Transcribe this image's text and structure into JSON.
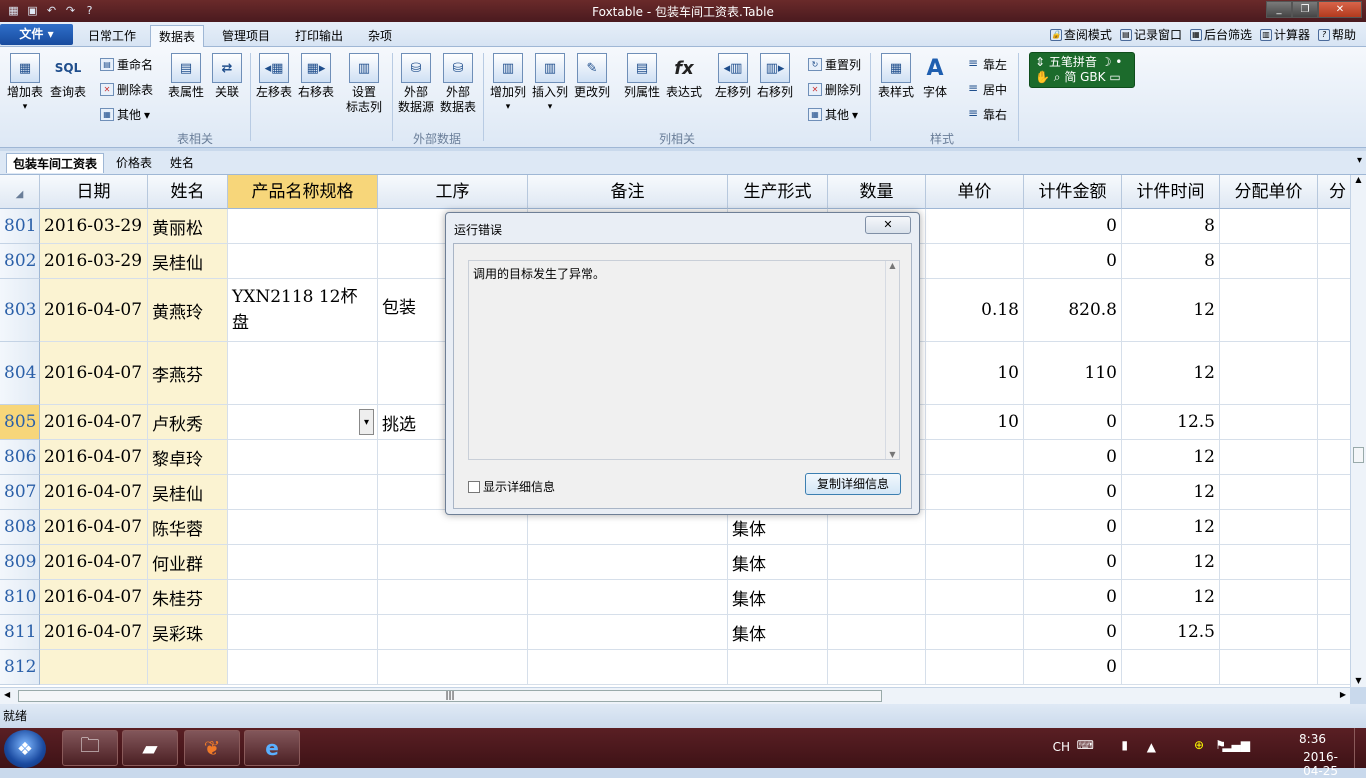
{
  "window": {
    "title": "Foxtable - 包装车间工资表.Table"
  },
  "menu": {
    "file_label": "文件",
    "tabs": [
      "日常工作",
      "数据表",
      "管理项目",
      "打印输出",
      "杂项"
    ],
    "active_tab": "数据表",
    "right_links": [
      "查阅模式",
      "记录窗口",
      "后台筛选",
      "计算器",
      "帮助"
    ]
  },
  "ribbon": {
    "add_table": "增加表",
    "query_table": "查询表",
    "sql": "SQL",
    "rename_table": "重命名",
    "delete_table": "删除表",
    "other": "其他",
    "table_props": "表属性",
    "relation": "关联",
    "move_left": "左移表",
    "move_right": "右移表",
    "set_flag_col": "设置\n标志列",
    "ext_source": "外部\n数据源",
    "ext_table": "外部\n数据表",
    "add_col": "增加列",
    "insert_col": "插入列",
    "change_col": "更改列",
    "col_props": "列属性",
    "expression": "表达式",
    "fx": "fx",
    "col_left": "左移列",
    "col_right": "右移列",
    "reset_col": "重置列",
    "delete_col": "删除列",
    "other2": "其他",
    "table_style": "表样式",
    "font": "字体",
    "font_glyph": "A",
    "align_left": "靠左",
    "align_center": "居中",
    "align_right": "靠右",
    "groups": {
      "table": "表相关",
      "external": "外部数据",
      "column": "列相关",
      "style": "样式"
    }
  },
  "ime": {
    "line1": "五笔拼音",
    "line2": "简 GBK"
  },
  "sheets": {
    "tabs": [
      "包装车间工资表",
      "价格表",
      "姓名"
    ],
    "active": "包装车间工资表"
  },
  "grid": {
    "columns": [
      "日期",
      "姓名",
      "产品名称规格",
      "工序",
      "备注",
      "生产形式",
      "数量",
      "单价",
      "计件金额",
      "计件时间",
      "分配单价",
      "分"
    ],
    "rows": [
      {
        "id": "801",
        "date": "2016-03-29",
        "name": "黄丽松",
        "product": "",
        "process": "",
        "note": "",
        "form": "",
        "qty": "",
        "price": "",
        "amount": "0",
        "time": "8"
      },
      {
        "id": "802",
        "date": "2016-03-29",
        "name": "吴桂仙",
        "product": "",
        "process": "",
        "note": "",
        "form": "",
        "qty": "",
        "price": "",
        "amount": "0",
        "time": "8"
      },
      {
        "id": "803",
        "date": "2016-04-07",
        "name": "黄燕玲",
        "product": "YXN2118  12杯盘",
        "process": "包装",
        "note": "",
        "form": "",
        "qty": "",
        "price": "0.18",
        "amount": "820.8",
        "time": "12"
      },
      {
        "id": "804",
        "date": "2016-04-07",
        "name": "李燕芬",
        "product": "",
        "process": "",
        "note": "",
        "form": "",
        "qty": "",
        "price": "10",
        "amount": "110",
        "time": "12"
      },
      {
        "id": "805",
        "date": "2016-04-07",
        "name": "卢秋秀",
        "product": "",
        "process": "挑选",
        "note": "",
        "form": "",
        "qty": "",
        "price": "10",
        "amount": "0",
        "time": "12.5"
      },
      {
        "id": "806",
        "date": "2016-04-07",
        "name": "黎卓玲",
        "product": "",
        "process": "",
        "note": "",
        "form": "",
        "qty": "",
        "price": "",
        "amount": "0",
        "time": "12"
      },
      {
        "id": "807",
        "date": "2016-04-07",
        "name": "吴桂仙",
        "product": "",
        "process": "",
        "note": "",
        "form": "",
        "qty": "",
        "price": "",
        "amount": "0",
        "time": "12"
      },
      {
        "id": "808",
        "date": "2016-04-07",
        "name": "陈华蓉",
        "product": "",
        "process": "",
        "note": "",
        "form": "集体",
        "qty": "",
        "price": "",
        "amount": "0",
        "time": "12"
      },
      {
        "id": "809",
        "date": "2016-04-07",
        "name": "何业群",
        "product": "",
        "process": "",
        "note": "",
        "form": "集体",
        "qty": "",
        "price": "",
        "amount": "0",
        "time": "12"
      },
      {
        "id": "810",
        "date": "2016-04-07",
        "name": "朱桂芬",
        "product": "",
        "process": "",
        "note": "",
        "form": "集体",
        "qty": "",
        "price": "",
        "amount": "0",
        "time": "12"
      },
      {
        "id": "811",
        "date": "2016-04-07",
        "name": "吴彩珠",
        "product": "",
        "process": "",
        "note": "",
        "form": "集体",
        "qty": "",
        "price": "",
        "amount": "0",
        "time": "12.5"
      },
      {
        "id": "812",
        "date": "",
        "name": "",
        "product": "",
        "process": "",
        "note": "",
        "form": "",
        "qty": "",
        "price": "",
        "amount": "0",
        "time": ""
      }
    ]
  },
  "dialog": {
    "title": "运行错误",
    "close_glyph": "✕",
    "message": "调用的目标发生了异常。",
    "show_details": "显示详细信息",
    "copy_details": "复制详细信息"
  },
  "status": {
    "text": "就绪"
  },
  "tray": {
    "lang": "CH",
    "time": "8:36",
    "date": "2016-04-25"
  }
}
